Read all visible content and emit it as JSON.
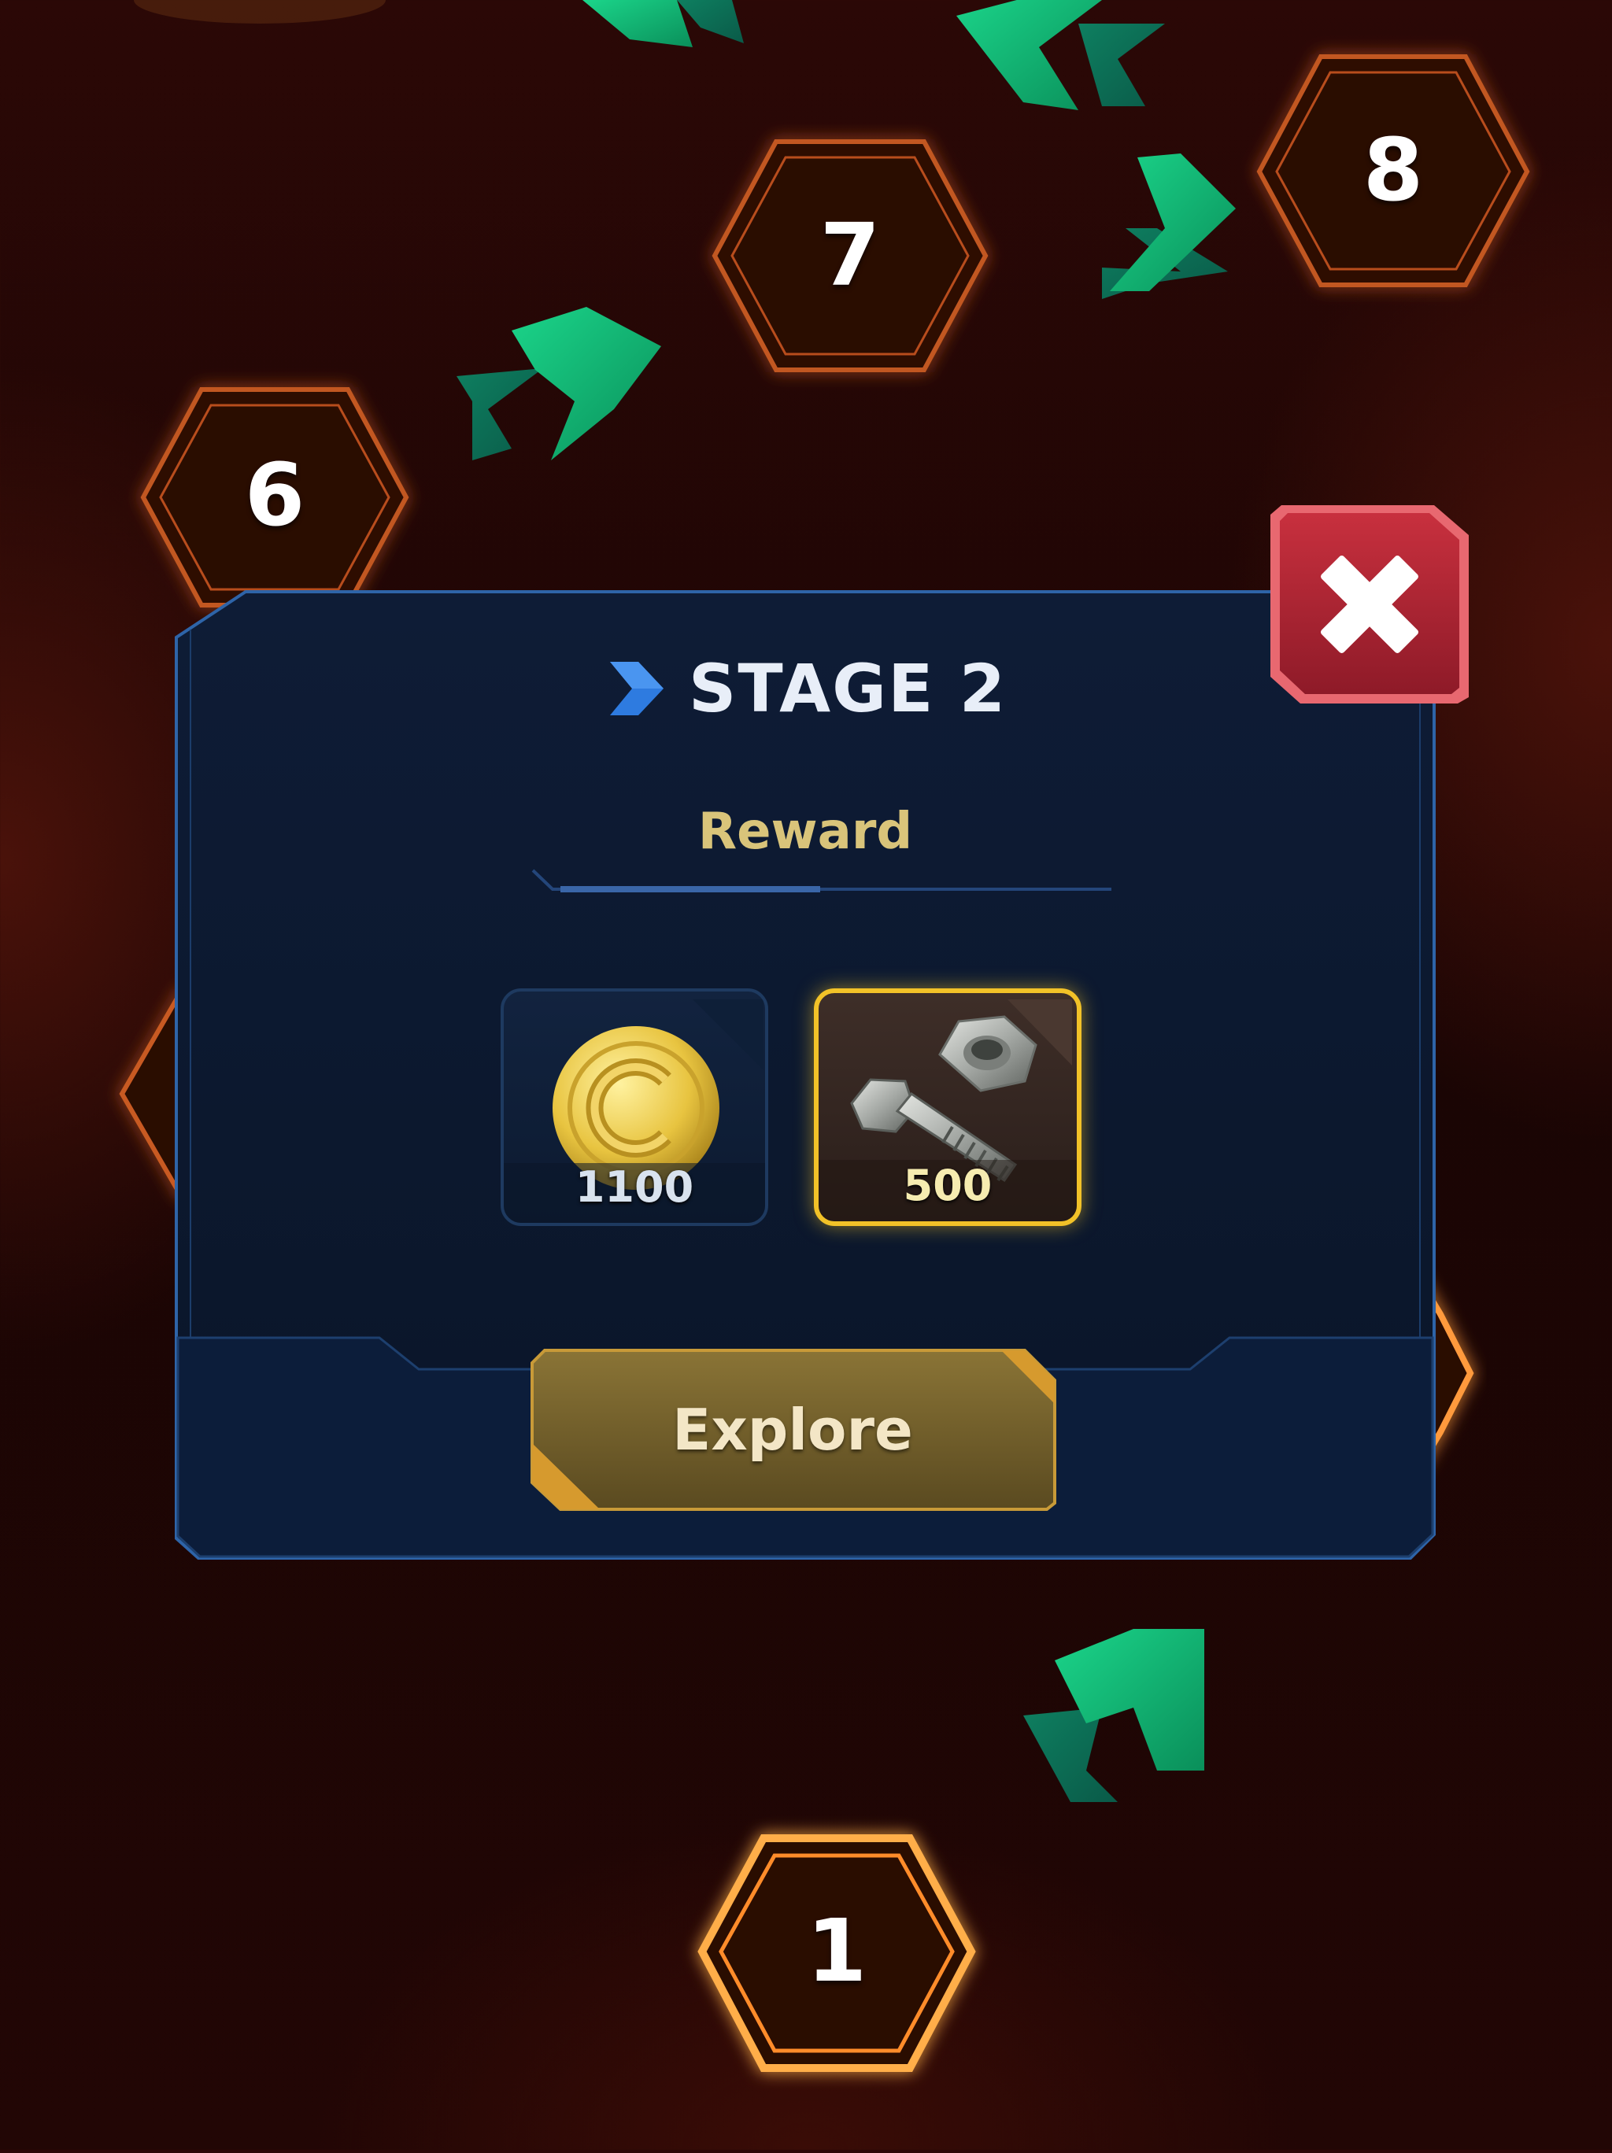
{
  "map": {
    "nodes": [
      {
        "label": "6",
        "state": "locked"
      },
      {
        "label": "7",
        "state": "locked"
      },
      {
        "label": "8",
        "state": "locked"
      },
      {
        "label": "1",
        "state": "active"
      }
    ],
    "accent_colors": {
      "node_outline": "#d26a2a",
      "node_active": "#ffae4a",
      "path_arrow": "#19c27a"
    }
  },
  "dialog": {
    "title": "STAGE 2",
    "section_title": "Reward",
    "rewards": [
      {
        "icon": "gold-coin-icon",
        "amount": "1100"
      },
      {
        "icon": "bolt-and-nut-icon",
        "amount": "500",
        "highlighted": true
      }
    ],
    "action_label": "Explore",
    "close_icon": "close-icon",
    "colors": {
      "panel": "#0b1730",
      "panel_border": "#2a5b9a",
      "reward_title": "#d9c47a",
      "button": "#7a6530",
      "close": "#b8283a"
    }
  }
}
